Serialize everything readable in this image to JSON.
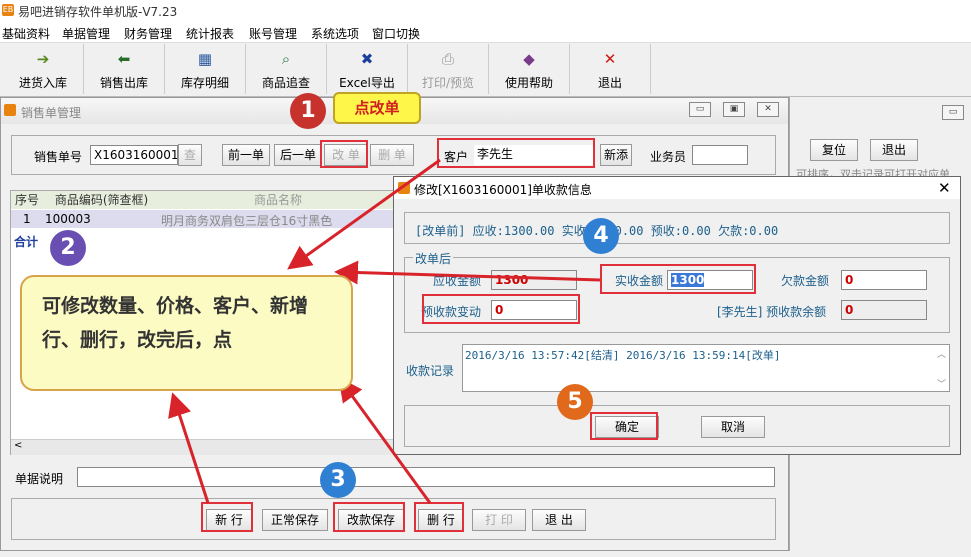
{
  "app": {
    "title": "易吧进销存软件单机版-V7.23"
  },
  "menu": [
    "基础资料",
    "单据管理",
    "财务管理",
    "统计报表",
    "账号管理",
    "系统选项",
    "窗口切换"
  ],
  "toolbar": [
    {
      "label": "进货入库",
      "icon": "import-icon"
    },
    {
      "label": "销售出库",
      "icon": "export-icon"
    },
    {
      "label": "库存明细",
      "icon": "inventory-icon"
    },
    {
      "label": "商品追查",
      "icon": "trace-icon"
    },
    {
      "label": "Excel导出",
      "icon": "excel-icon"
    },
    {
      "label": "打印/预览",
      "icon": "print-icon"
    },
    {
      "label": "使用帮助",
      "icon": "help-icon"
    },
    {
      "label": "退出",
      "icon": "close-icon"
    }
  ],
  "sales": {
    "window_title": "销售单管理",
    "order_no_label": "销售单号",
    "order_no": "X1603160001",
    "query_btn": "查",
    "prev_btn": "前一单",
    "next_btn": "后一单",
    "modify_btn": "改 单",
    "delete_btn": "删 单",
    "customer_label": "客户",
    "customer": "李先生",
    "new_customer_btn": "新添",
    "salesman_label": "业务员",
    "salesman": "",
    "grid_headers": [
      "序号",
      "商品编码(筛查框)",
      "商品名称"
    ],
    "rows": [
      {
        "seq": "1",
        "code": "100003",
        "name": "明月商务双肩包三层仓16寸黑色"
      }
    ],
    "total_label": "合计",
    "note_label": "单据说明",
    "bottom_buttons": [
      "新 行",
      "正常保存",
      "改款保存",
      "删 行",
      "打 印",
      "退 出"
    ]
  },
  "background_window": {
    "reset_btn": "复位",
    "back_btn": "退出",
    "hint": "可排序，双击记录可打开对应单"
  },
  "dialog": {
    "title": "修改[X1603160001]单收款信息",
    "before_summary": "[改单前] 应收:1300.00 实收:1300.00 预收:0.00 欠款:0.00",
    "after_legend": "改单后",
    "receivable_label": "应收金额",
    "receivable": "1300",
    "paid_label": "实收金额",
    "paid": "1300",
    "owed_label": "欠款金额",
    "owed": "0",
    "prepay_change_label": "预收款变动",
    "prepay_change": "0",
    "prepay_balance_label": "[李先生] 预收款余额",
    "prepay_balance": "0",
    "records_label": "收款记录",
    "records": "2016/3/16 13:57:42[结清]  2016/3/16 13:59:14[改单]",
    "ok_btn": "确定",
    "cancel_btn": "取消"
  },
  "annotations": {
    "step1": "1",
    "step1_label": "点改单",
    "step2": "2",
    "step2_text": "可修改数量、价格、客户、新增行、删行，改完后，点",
    "step3": "3",
    "step4": "4",
    "step5": "5"
  },
  "colors": {
    "red_highlight": "#e0303a",
    "callout_yellow": "#fdfbc4",
    "step_red": "#c8322c",
    "step_blue": "#2f7fd3",
    "step_purple": "#6a4fb3",
    "step_orange": "#e1691b"
  }
}
